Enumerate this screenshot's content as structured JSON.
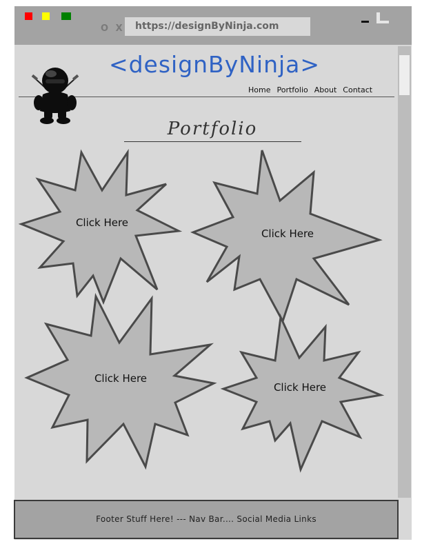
{
  "browser": {
    "nav_buttons": "O X",
    "url": "https://designByNinja.com",
    "window_controls": {
      "close_color": "#ff0000",
      "minimize_color": "#ffff00",
      "maximize_color": "#008000"
    }
  },
  "header": {
    "site_title": "<designByNinja>",
    "logo_icon": "ninja-icon",
    "title_color": "#2f62c4",
    "nav": [
      {
        "label": "Home"
      },
      {
        "label": "Portfolio"
      },
      {
        "label": "About"
      },
      {
        "label": "Contact"
      }
    ]
  },
  "main": {
    "heading": "Portfolio",
    "items": [
      {
        "label": "Click Here",
        "icon": "star-burst"
      },
      {
        "label": "Click Here",
        "icon": "star-burst"
      },
      {
        "label": "Click Here",
        "icon": "star-burst"
      },
      {
        "label": "Click Here",
        "icon": "star-burst"
      }
    ]
  },
  "footer": {
    "text": "Footer Stuff Here! --- Nav Bar.... Social Media Links"
  }
}
